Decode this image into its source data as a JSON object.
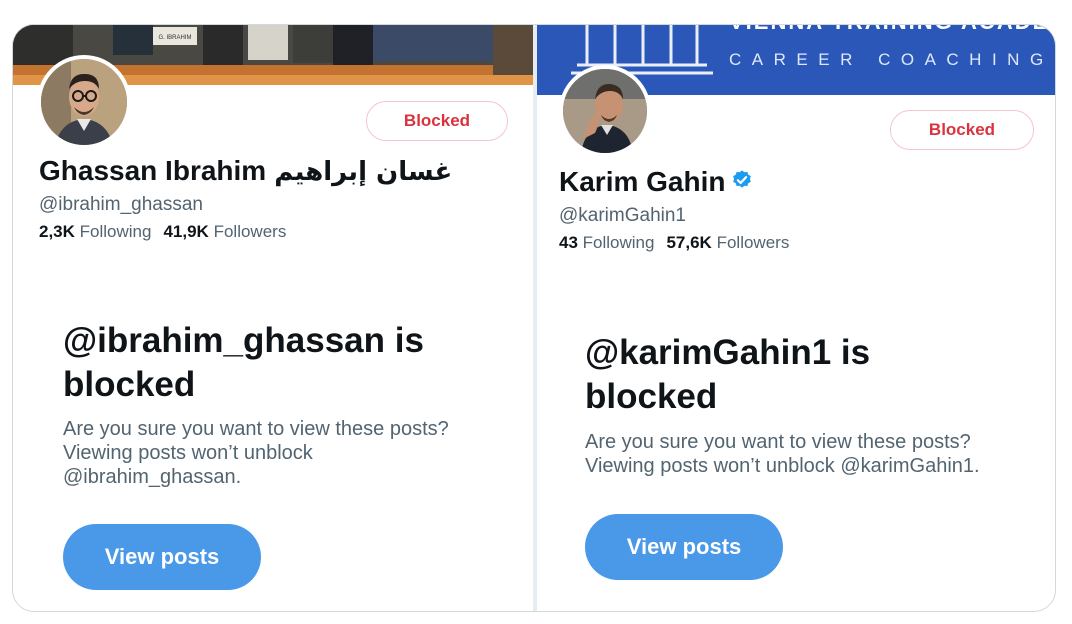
{
  "profiles": [
    {
      "blocked_label": "Blocked",
      "display_name": "Ghassan Ibrahim",
      "display_name_arabic": "غسان إبراهيم",
      "handle": "@ibrahim_ghassan",
      "following_count": "2,3K",
      "following_label": "Following",
      "followers_count": "41,9K",
      "followers_label": "Followers",
      "blocked_title": "@ibrahim_ghassan is blocked",
      "blocked_description": "Are you sure you want to view these posts? Viewing posts won’t unblock @ibrahim_ghassan.",
      "view_button_label": "View posts",
      "banner_text": "G. IBRAHIM"
    },
    {
      "blocked_label": "Blocked",
      "display_name": "Karim Gahin",
      "verified": true,
      "handle": "@karimGahin1",
      "following_count": "43",
      "following_label": "Following",
      "followers_count": "57,6K",
      "followers_label": "Followers",
      "blocked_title": "@karimGahin1 is blocked",
      "blocked_description": "Are you sure you want to view these posts? Viewing posts won’t unblock @karimGahin1.",
      "view_button_label": "View posts",
      "banner_text": "VIENNA TRAINING ACADEMY",
      "banner_subtext": "CAREER COACHING"
    }
  ],
  "colors": {
    "accent": "#4a99e9",
    "blocked_red": "#d9343e",
    "verified_blue": "#1d9bf0",
    "right_banner": "#2b58b8"
  }
}
